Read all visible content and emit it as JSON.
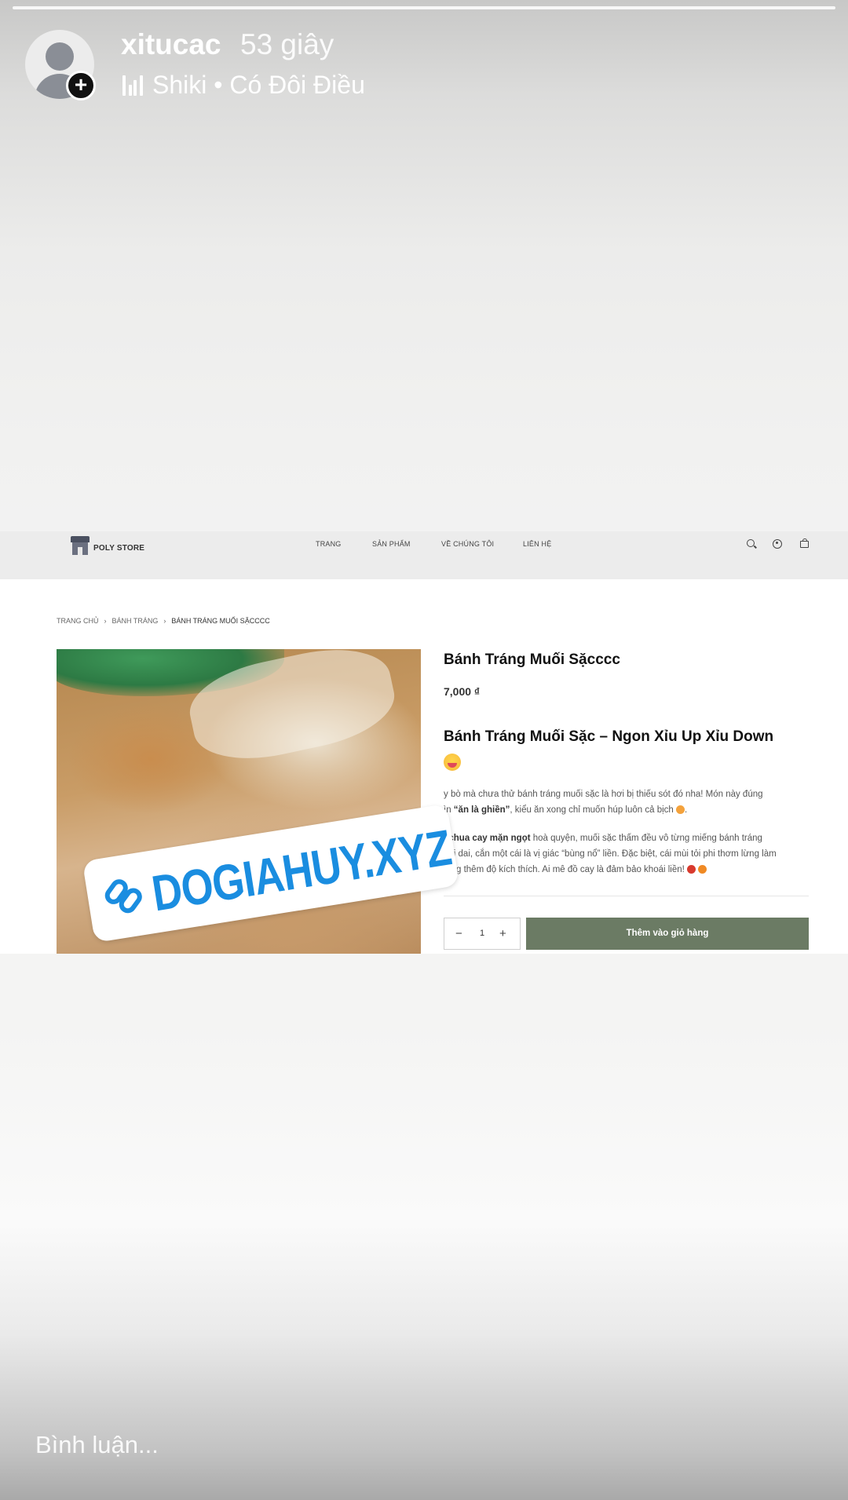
{
  "story": {
    "username": "xitucac",
    "time": "53 giây",
    "music": "Shiki • Có Đôi Điều",
    "comment_placeholder": "Bình luận..."
  },
  "site": {
    "logo_text": "POLY STORE",
    "nav": [
      "TRANG",
      "SẢN PHẨM",
      "VỀ CHÚNG TÔI",
      "LIÊN HỆ"
    ],
    "breadcrumb": [
      "TRANG CHỦ",
      "BÁNH TRÁNG",
      "BÁNH TRÁNG MUỐI SẶCCCC"
    ],
    "sticker_text": "DOGIAHUY.XYZ",
    "product": {
      "title": "Bánh Tráng Muối Sặcccc",
      "price": "7,000 ₫",
      "heading": "Bánh Tráng Muối Sặc – Ngon Xỉu Up Xỉu Down",
      "desc1_a": "y bò mà chưa thử bánh tráng muối sặc là hơi bị thiếu sót đó nha! Món này đúng",
      "desc1_b_pre": "ìn ",
      "desc1_b_bold": "“ăn là ghiền”",
      "desc1_b_post": ", kiểu ăn xong chỉ muốn húp luôn cả bịch",
      "desc2_bold": "ị chua cay mặn ngọt",
      "desc2_a": " hoà quyện, muối sặc thấm đều vô từng miếng bánh tráng",
      "desc2_b": "dai dai, cắn một cái là vị giác “bùng nổ” liền. Đặc biệt, cái mùi tỏi phi thơm lừng làm",
      "desc2_c": "tăng thêm độ kích thích. Ai mê đồ cay là đảm bảo khoái liền!",
      "quantity": "1",
      "add_to_cart": "Thêm vào giỏ hàng"
    }
  },
  "colors": {
    "add_to_cart_bg": "#6b7b64",
    "sticker_blue": "#1a8de0"
  }
}
